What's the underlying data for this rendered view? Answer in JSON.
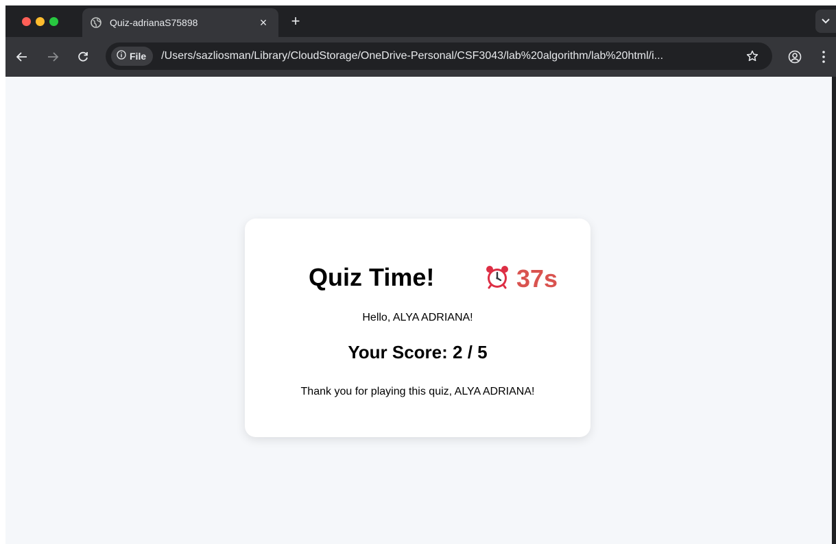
{
  "browser": {
    "tab": {
      "title": "Quiz-adrianaS75898",
      "favicon": "globe-icon"
    },
    "address_bar": {
      "chip_label": "File",
      "url": "/Users/sazliosman/Library/CloudStorage/OneDrive-Personal/CSF3043/lab%20algorithm/lab%20html/i..."
    },
    "icons": {
      "back": "arrow-left-icon",
      "forward": "arrow-right-icon",
      "reload": "reload-icon",
      "info": "info-icon",
      "bookmark": "star-icon",
      "profile": "profile-icon",
      "menu": "kebab-menu-icon",
      "new_tab": "plus-icon",
      "close_tab": "close-icon",
      "tab_search": "chevron-down-icon"
    }
  },
  "page": {
    "title": "Quiz Time!",
    "timer": {
      "icon": "alarm-clock-icon",
      "value": "37s",
      "color": "#d9534f"
    },
    "greeting": "Hello, ALYA ADRIANA!",
    "score_text": "Your Score: 2 / 5",
    "thanks_text": "Thank you for playing this quiz, ALYA ADRIANA!"
  },
  "colors": {
    "page_background": "#f5f7fa",
    "card_background": "#ffffff",
    "browser_frame": "#202124",
    "toolbar": "#35363a",
    "accent_timer": "#d9534f"
  }
}
